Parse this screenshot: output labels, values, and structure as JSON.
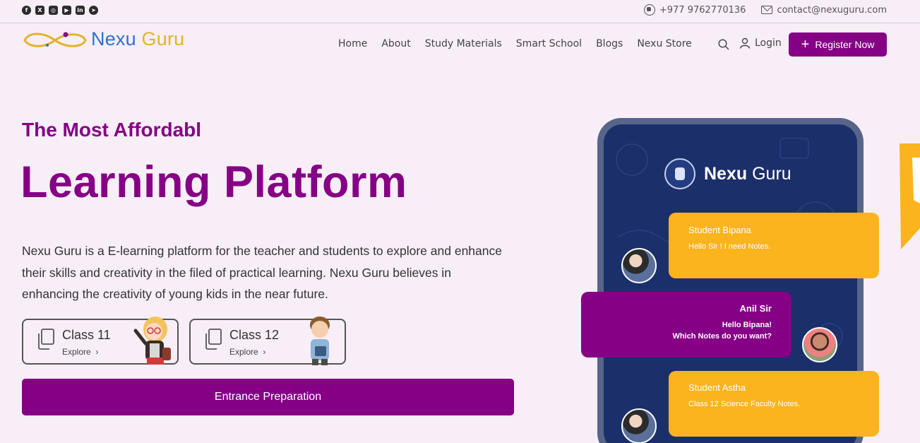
{
  "topbar": {
    "socials": [
      {
        "icon": "facebook-icon",
        "glyph": "f"
      },
      {
        "icon": "x-icon",
        "glyph": "X"
      },
      {
        "icon": "instagram-icon",
        "glyph": "◎"
      },
      {
        "icon": "youtube-icon",
        "glyph": "▶"
      },
      {
        "icon": "linkedin-icon",
        "glyph": "in"
      },
      {
        "icon": "telegram-icon",
        "glyph": "➤"
      }
    ],
    "phone": "+977 9762770136",
    "email": "contact@nexuguru.com"
  },
  "brand": {
    "name_part1": "Nexu",
    "name_part2": "Guru"
  },
  "nav": {
    "items": [
      "Home",
      "About",
      "Study Materials",
      "Smart School",
      "Blogs",
      "Nexu Store"
    ],
    "login": "Login",
    "register": "Register Now"
  },
  "hero": {
    "eyebrow": "The Most Affordabl",
    "headline": "Learning Platform",
    "description": "Nexu Guru is a E-learning platform for the teacher and students to explore and enhance their skills and creativity in the filed of practical learning. Nexu Guru believes in enhancing the creativity of young kids in the near future.",
    "classes": [
      {
        "name": "Class 11",
        "link": "Explore"
      },
      {
        "name": "Class 12",
        "link": "Explore"
      }
    ],
    "entrance_button": "Entrance Preparation"
  },
  "phone_mockup": {
    "brand_bold": "Nexu",
    "brand_regular": "Guru",
    "messages": [
      {
        "sender": "Student Bipana",
        "text": "Hello Sir ! I need Notes."
      },
      {
        "sender": "Anil Sir",
        "text_line1": "Hello Bipana!",
        "text_line2": "Which Notes do you want?"
      },
      {
        "sender": "Student Astha",
        "text": "Class 12 Science Faculty Notes."
      }
    ]
  },
  "colors": {
    "primary": "#850085",
    "accent": "#fbb41e",
    "phone_screen": "#1b2f6b",
    "background": "#f8eef8"
  }
}
